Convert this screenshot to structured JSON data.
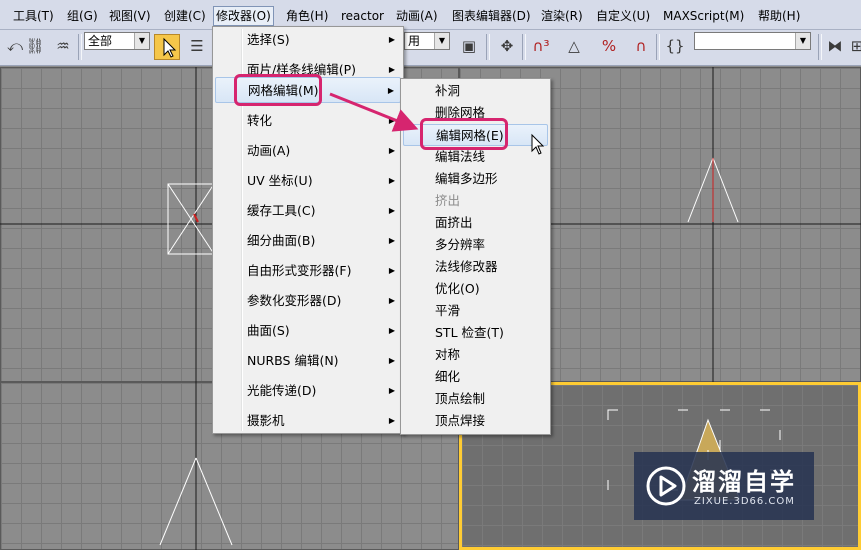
{
  "menubar": {
    "items": [
      "工具(T)",
      "组(G)",
      "视图(V)",
      "创建(C)",
      "修改器(O)",
      "角色(H)",
      "reactor",
      "动画(A)",
      "图表编辑器(D)",
      "渲染(R)",
      "自定义(U)",
      "MAXScript(M)",
      "帮助(H)"
    ],
    "active_index": 4
  },
  "toolbar": {
    "selection_filter": "全部",
    "combo2_value": "用",
    "named_selection": ""
  },
  "modifier_menu": {
    "items": [
      {
        "label": "选择(S)",
        "submenu": true
      },
      {
        "label": "面片/样条线编辑(P)",
        "submenu": true
      },
      {
        "label": "网格编辑(M)",
        "submenu": true,
        "highlighted": true
      },
      {
        "label": "转化",
        "submenu": true
      },
      {
        "label": "动画(A)",
        "submenu": true
      },
      {
        "label": "UV 坐标(U)",
        "submenu": true
      },
      {
        "label": "缓存工具(C)",
        "submenu": true
      },
      {
        "label": "细分曲面(B)",
        "submenu": true
      },
      {
        "label": "自由形式变形器(F)",
        "submenu": true
      },
      {
        "label": "参数化变形器(D)",
        "submenu": true
      },
      {
        "label": "曲面(S)",
        "submenu": true
      },
      {
        "label": "NURBS 编辑(N)",
        "submenu": true
      },
      {
        "label": "光能传递(D)",
        "submenu": true
      },
      {
        "label": "摄影机",
        "submenu": true
      }
    ]
  },
  "mesh_edit_submenu": {
    "items": [
      {
        "label": "补洞"
      },
      {
        "label": "删除网格"
      },
      {
        "label": "编辑网格(E)",
        "highlighted": true
      },
      {
        "label": "编辑法线"
      },
      {
        "label": "编辑多边形"
      },
      {
        "label": "挤出",
        "disabled": true
      },
      {
        "label": "面挤出"
      },
      {
        "label": "多分辨率"
      },
      {
        "label": "法线修改器"
      },
      {
        "label": "优化(O)"
      },
      {
        "label": "平滑"
      },
      {
        "label": "STL 检查(T)"
      },
      {
        "label": "对称"
      },
      {
        "label": "细化"
      },
      {
        "label": "顶点绘制"
      },
      {
        "label": "顶点焊接"
      }
    ]
  },
  "watermark": {
    "brand": "溜溜自学",
    "url": "ZIXUE.3D66.COM"
  },
  "colors": {
    "callout": "#d6256f",
    "active_viewport": "#ffcc33",
    "viewport_bg": "#8c8c8c",
    "selection_tool": "#f5c64a"
  },
  "icons": [
    "select-arrow-icon",
    "select-by-name-icon",
    "move-icon",
    "snap-3d-icon",
    "angle-snap-icon",
    "percent-snap-icon",
    "spinner-snap-icon",
    "edit-named-selection-icon",
    "mirror-icon",
    "align-icon",
    "mouse-cursor-icon"
  ]
}
